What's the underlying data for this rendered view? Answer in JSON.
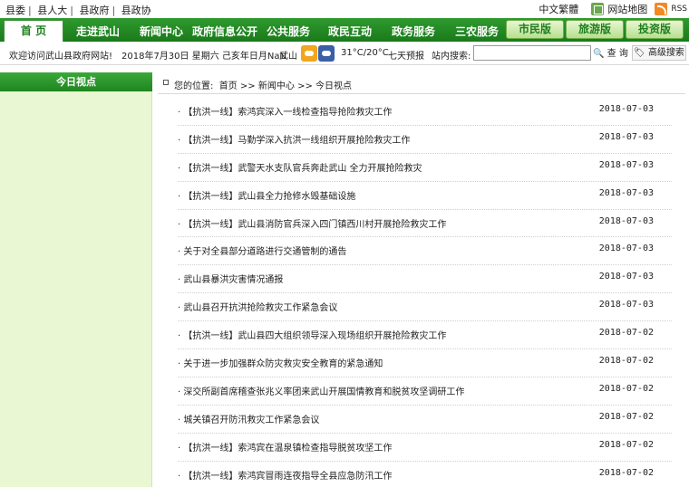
{
  "top_links": [
    "县委",
    "县人大",
    "县政府",
    "县政协"
  ],
  "top_right": {
    "lang": "中文繁體",
    "sitemap": "网站地图",
    "rss": "RSS"
  },
  "nav": {
    "home": "首 页",
    "items": [
      "走进武山",
      "新闻中心",
      "政府信息公开",
      "公共服务",
      "政民互动",
      "政务服务",
      "三农服务"
    ],
    "pills": [
      "市民版",
      "旅游版",
      "投资版"
    ]
  },
  "info": {
    "welcome": "欢迎访问武山县政府网站!",
    "date": "2018年7月30日 星期六 己亥年日月NaN",
    "city": "武山",
    "temp": "31°C/20°C",
    "forecast": "七天预报",
    "search_label": "站内搜索:",
    "search_value": "",
    "search_button": "查 询",
    "advanced_search": "高级搜索"
  },
  "sidebar": {
    "title": "今日视点"
  },
  "breadcrumb": {
    "label": "您的位置:",
    "path": [
      "首页",
      "新闻中心",
      "今日视点"
    ],
    "sep": ">>"
  },
  "news": [
    {
      "title": "【抗洪一线】索鸿宾深入一线检查指导抢险救灾工作",
      "date": "2018-07-03"
    },
    {
      "title": "【抗洪一线】马勤学深入抗洪一线组织开展抢险救灾工作",
      "date": "2018-07-03"
    },
    {
      "title": "【抗洪一线】武警天水支队官兵奔赴武山 全力开展抢险救灾",
      "date": "2018-07-03"
    },
    {
      "title": "【抗洪一线】武山县全力抢修水毁基础设施",
      "date": "2018-07-03"
    },
    {
      "title": "【抗洪一线】武山县消防官兵深入四门镇西川村开展抢险救灾工作",
      "date": "2018-07-03"
    },
    {
      "title": "关于对全县部分道路进行交通管制的通告",
      "date": "2018-07-03"
    },
    {
      "title": "武山县暴洪灾害情况通报",
      "date": "2018-07-03"
    },
    {
      "title": "武山县召开抗洪抢险救灾工作紧急会议",
      "date": "2018-07-03"
    },
    {
      "title": "【抗洪一线】武山县四大组织领导深入现场组织开展抢险救灾工作",
      "date": "2018-07-02"
    },
    {
      "title": "关于进一步加强群众防灾救灾安全教育的紧急通知",
      "date": "2018-07-02"
    },
    {
      "title": "深交所副首席稽查张兆义率团来武山开展国情教育和脱贫攻坚调研工作",
      "date": "2018-07-02"
    },
    {
      "title": "城关镇召开防汛救灾工作紧急会议",
      "date": "2018-07-02"
    },
    {
      "title": "【抗洪一线】索鸿宾在温泉镇检查指导脱贫攻坚工作",
      "date": "2018-07-02"
    },
    {
      "title": "【抗洪一线】索鸿宾冒雨连夜指导全县应急防汛工作",
      "date": "2018-07-02"
    }
  ]
}
